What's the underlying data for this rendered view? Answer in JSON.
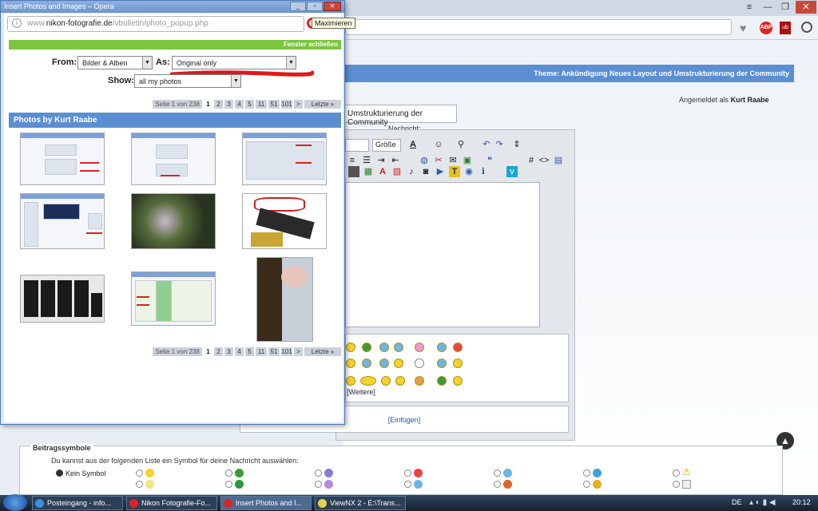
{
  "background_window": {
    "controls": {
      "minimize": "—",
      "restore": "❐",
      "close": "✕"
    },
    "thread_bar": {
      "prefix": "Theme:",
      "title": "Ankündigung Neues Layout und Umstrukturierung der Community"
    },
    "logged_in": {
      "prefix": "Angemeldet als",
      "user": "Kurt Raabe"
    },
    "title_field_value": "Umstrukturierung der Community",
    "message_label": "Nachricht:",
    "editor": {
      "size_select": "Größe",
      "font_color": "A"
    },
    "more_smilies": "[Weitere]",
    "insert_link": "[Einfügen]",
    "post_icons": {
      "legend": "Beitragssymbole",
      "description": "Du kannst aus der folgenden Liste ein Symbol für deine Nachricht auswählen:",
      "none_label": "Kein Symbol"
    }
  },
  "popup": {
    "title": "Insert Photos and Images – Opera",
    "url": {
      "scheme_host_pre": "www.",
      "host": "nikon-fotografie.de",
      "path": "/vbulletin/photo_popup.php"
    },
    "tooltip": "Maximieren",
    "close_link": "Fenster schließen",
    "from": {
      "label": "From:",
      "value": "Bilder & Alben"
    },
    "as": {
      "label": "As:",
      "value": "Original only"
    },
    "show": {
      "label": "Show:",
      "value": "all my photos"
    },
    "pager": {
      "info": "Seite 1 von 238",
      "pages": [
        "1",
        "2",
        "3",
        "4",
        "5",
        "11",
        "51",
        "101",
        ">",
        "Letzte »"
      ]
    },
    "section_title": "Photos by Kurt Raabe",
    "thumbnails": [
      "screenshot",
      "screenshot",
      "screenshot",
      "screenshot",
      "flower photo",
      "camera strap photo",
      "flash units photo",
      "table screenshot",
      "flowers portrait photo"
    ]
  },
  "taskbar": {
    "items": [
      {
        "label": "Posteingang - info...",
        "icon": "mail-icon"
      },
      {
        "label": "Nikon Fotografie-Fo...",
        "icon": "opera-icon"
      },
      {
        "label": "Insert Photos and I...",
        "icon": "opera-icon"
      },
      {
        "label": "ViewNX 2 - E:\\Trans...",
        "icon": "viewnx-icon"
      }
    ],
    "lang": "DE",
    "clock": "20:12"
  },
  "colors": {
    "header_blue": "#5b8fd2",
    "green_bar": "#7dc43f",
    "taskbar": "#1d2c3f"
  }
}
